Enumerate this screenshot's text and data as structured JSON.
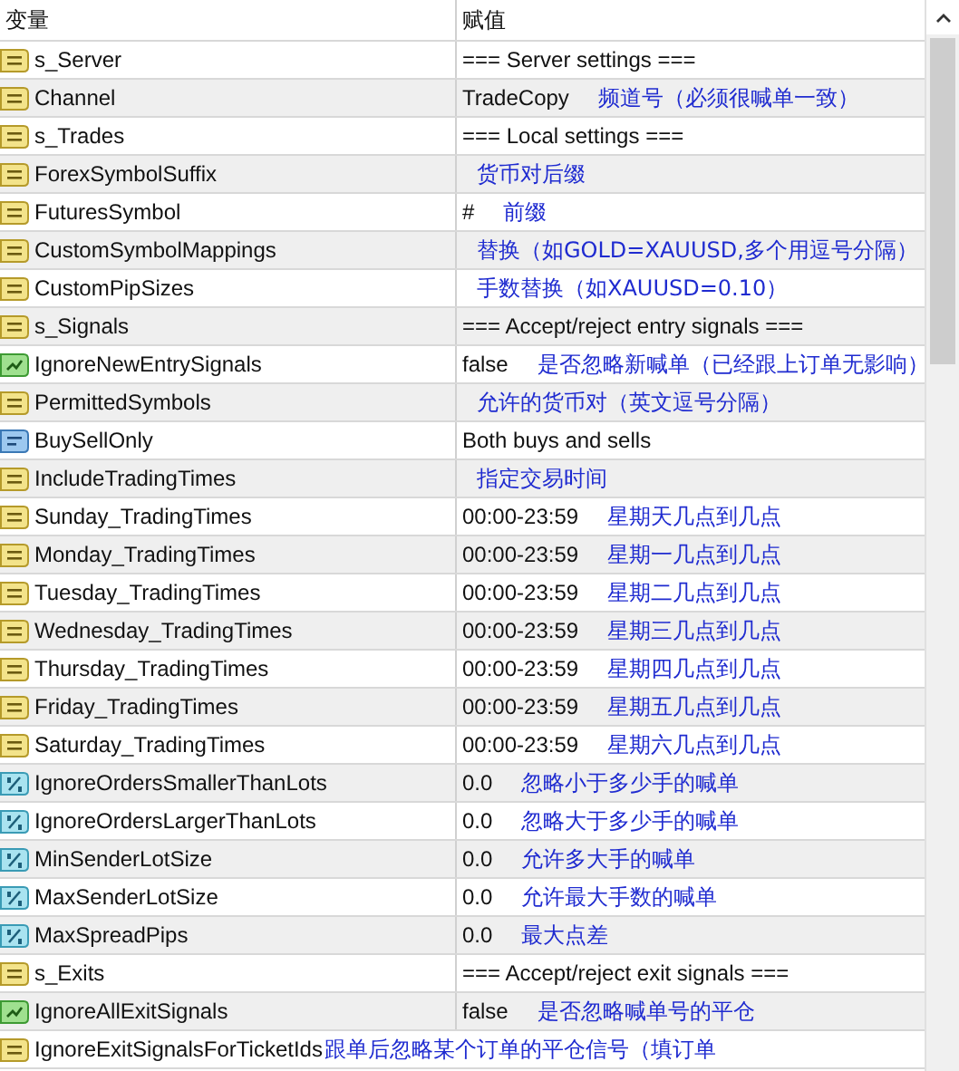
{
  "table": {
    "columns": [
      "变量",
      "赋值"
    ],
    "rows": [
      {
        "kind": "string",
        "name": "s_Server",
        "value": "=== Server settings ==="
      },
      {
        "kind": "string",
        "name": "Channel",
        "value": "TradeCopy",
        "note": "频道号（必须很喊单一致）"
      },
      {
        "kind": "string",
        "name": "s_Trades",
        "value": "=== Local settings ==="
      },
      {
        "kind": "string",
        "name": "ForexSymbolSuffix",
        "note": "货币对后缀"
      },
      {
        "kind": "string",
        "name": "FuturesSymbol",
        "value": "#",
        "note": "前缀"
      },
      {
        "kind": "string",
        "name": "CustomSymbolMappings",
        "note": "替换（如GOLD=XAUUSD,多个用逗号分隔）"
      },
      {
        "kind": "string",
        "name": "CustomPipSizes",
        "note": "手数替换（如XAUUSD=0.10）"
      },
      {
        "kind": "string",
        "name": "s_Signals",
        "value": "=== Accept/reject entry signals ==="
      },
      {
        "kind": "bool",
        "name": "IgnoreNewEntrySignals",
        "value": "false",
        "note": "是否忽略新喊单（已经跟上订单无影响）"
      },
      {
        "kind": "string",
        "name": "PermittedSymbols",
        "note": "允许的货币对（英文逗号分隔）"
      },
      {
        "kind": "enum",
        "name": "BuySellOnly",
        "value": "Both buys and sells"
      },
      {
        "kind": "string",
        "name": "IncludeTradingTimes",
        "note": "指定交易时间"
      },
      {
        "kind": "string",
        "name": "Sunday_TradingTimes",
        "value": "00:00-23:59",
        "note": "星期天几点到几点"
      },
      {
        "kind": "string",
        "name": "Monday_TradingTimes",
        "value": "00:00-23:59",
        "note": "星期一几点到几点"
      },
      {
        "kind": "string",
        "name": "Tuesday_TradingTimes",
        "value": "00:00-23:59",
        "note": "星期二几点到几点"
      },
      {
        "kind": "string",
        "name": "Wednesday_TradingTimes",
        "value": "00:00-23:59",
        "note": "星期三几点到几点"
      },
      {
        "kind": "string",
        "name": "Thursday_TradingTimes",
        "value": "00:00-23:59",
        "note": "星期四几点到几点"
      },
      {
        "kind": "string",
        "name": "Friday_TradingTimes",
        "value": "00:00-23:59",
        "note": "星期五几点到几点"
      },
      {
        "kind": "string",
        "name": "Saturday_TradingTimes",
        "value": "00:00-23:59",
        "note": "星期六几点到几点"
      },
      {
        "kind": "double",
        "name": "IgnoreOrdersSmallerThanLots",
        "value": "0.0",
        "note": "忽略小于多少手的喊单"
      },
      {
        "kind": "double",
        "name": "IgnoreOrdersLargerThanLots",
        "value": "0.0",
        "note": "忽略大于多少手的喊单"
      },
      {
        "kind": "double",
        "name": "MinSenderLotSize",
        "value": "0.0",
        "note": "允许多大手的喊单"
      },
      {
        "kind": "double",
        "name": "MaxSenderLotSize",
        "value": "0.0",
        "note": "允许最大手数的喊单"
      },
      {
        "kind": "double",
        "name": "MaxSpreadPips",
        "value": "0.0",
        "note": "最大点差"
      },
      {
        "kind": "string",
        "name": "s_Exits",
        "value": "=== Accept/reject exit signals ==="
      },
      {
        "kind": "bool",
        "name": "IgnoreAllExitSignals",
        "value": "false",
        "note": "是否忽略喊单号的平仓"
      },
      {
        "kind": "string",
        "name": "IgnoreExitSignalsForTicketIds",
        "note": "跟单后忽略某个订单的平仓信号（填订单",
        "note_after_name": true
      }
    ]
  }
}
